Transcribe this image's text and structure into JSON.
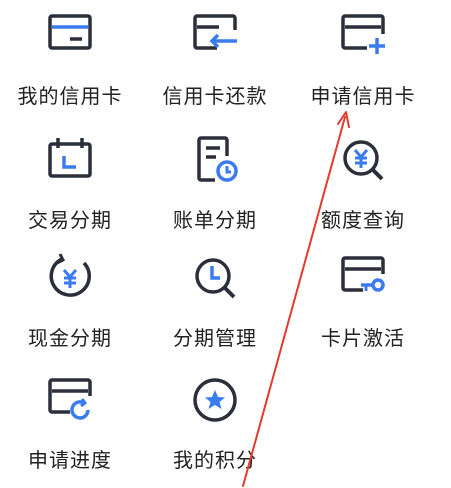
{
  "menu": {
    "items": [
      {
        "label": "我的信用卡",
        "icon": "credit-card-icon"
      },
      {
        "label": "信用卡还款",
        "icon": "card-repayment-icon"
      },
      {
        "label": "申请信用卡",
        "icon": "card-add-icon"
      },
      {
        "label": "交易分期",
        "icon": "calendar-installment-icon"
      },
      {
        "label": "账单分期",
        "icon": "bill-clock-icon"
      },
      {
        "label": "额度查询",
        "icon": "yen-search-icon"
      },
      {
        "label": "现金分期",
        "icon": "yen-cycle-icon"
      },
      {
        "label": "分期管理",
        "icon": "clock-search-icon"
      },
      {
        "label": "卡片激活",
        "icon": "card-key-icon"
      },
      {
        "label": "申请进度",
        "icon": "card-refresh-icon"
      },
      {
        "label": "我的积分",
        "icon": "star-circle-icon"
      }
    ]
  },
  "colors": {
    "icon_dark": "#2b2f3a",
    "icon_accent": "#3a7bf0",
    "annotation_arrow": "#e23b2e"
  }
}
